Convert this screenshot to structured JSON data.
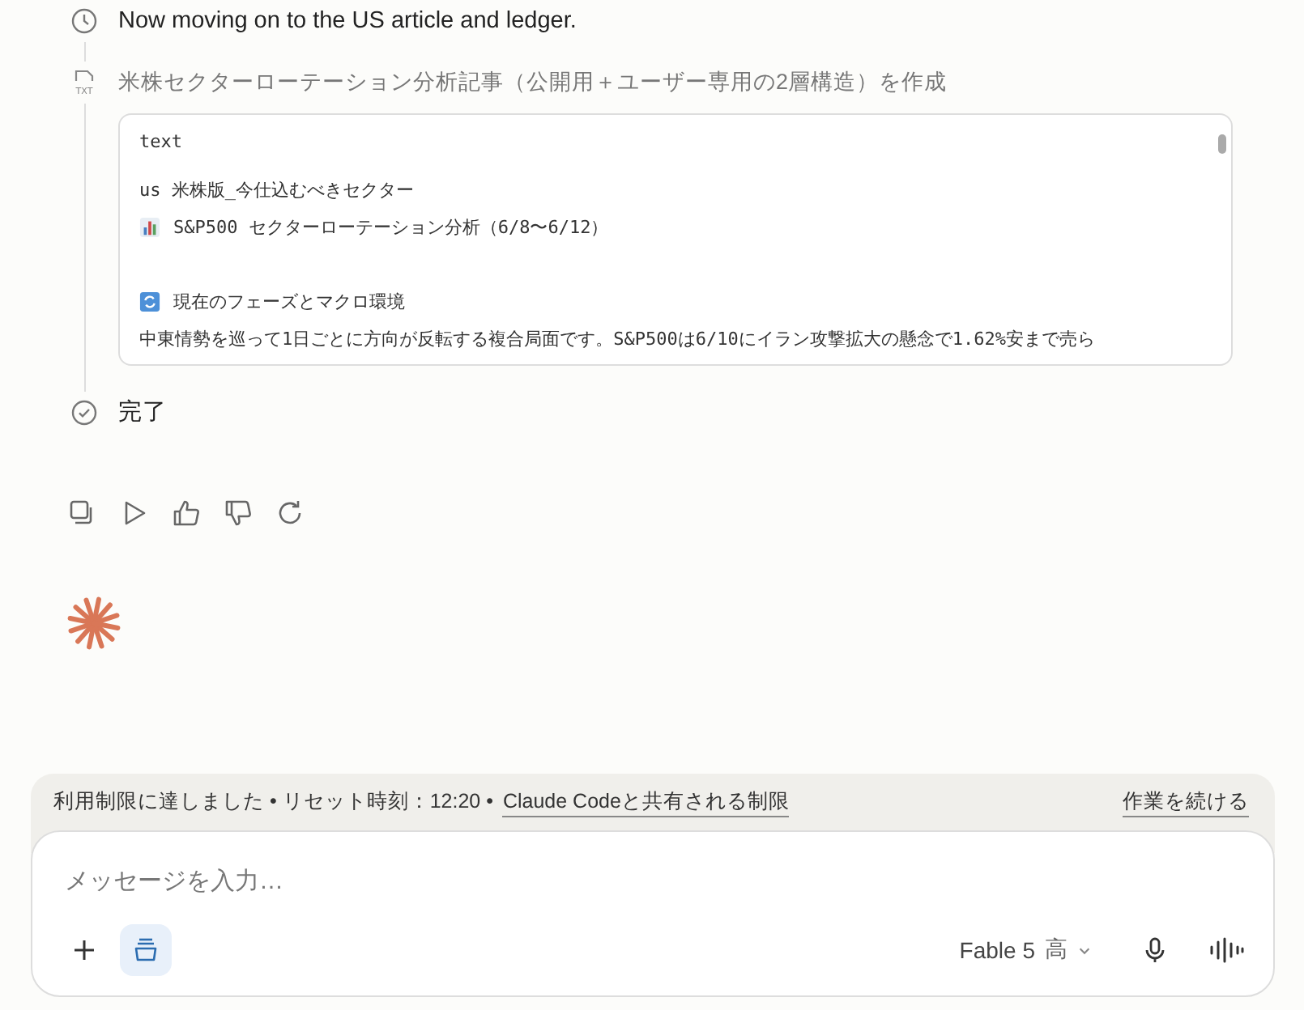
{
  "timeline": [
    {
      "kind": "clock",
      "text": "Now moving on to the US article and ledger."
    },
    {
      "kind": "file",
      "badge": "TXT",
      "text": "米株セクターローテーション分析記事（公開用＋ユーザー専用の2層構造）を作成",
      "code": {
        "language": "text",
        "lines": [
          {
            "kind": "plain",
            "text": "us 米株版_今仕込むべきセクター"
          },
          {
            "kind": "chart",
            "text": "S&P500 セクターローテーション分析（6/8〜6/12）"
          },
          {
            "kind": "blank"
          },
          {
            "kind": "cycle",
            "text": "現在のフェーズとマクロ環境"
          },
          {
            "kind": "plain",
            "text": "中東情勢を巡って1日ごとに方向が反転する複合局面です。S&P500は6/10にイラン攻撃拡大の懸念で1.62%安まで売ら"
          }
        ]
      }
    },
    {
      "kind": "done",
      "text": "完了"
    }
  ],
  "actions": [
    {
      "kind": "copy"
    },
    {
      "kind": "play"
    },
    {
      "kind": "thumbs-up"
    },
    {
      "kind": "thumbs-down"
    },
    {
      "kind": "retry"
    }
  ],
  "limit_bar": {
    "message": "利用制限に達しました • リセット時刻：12:20 •",
    "link": "Claude Codeと共有される制限",
    "continue": "作業を続ける"
  },
  "composer": {
    "placeholder": "メッセージを入力…",
    "tool_on": true,
    "model": "Fable 5",
    "effort": "高"
  }
}
